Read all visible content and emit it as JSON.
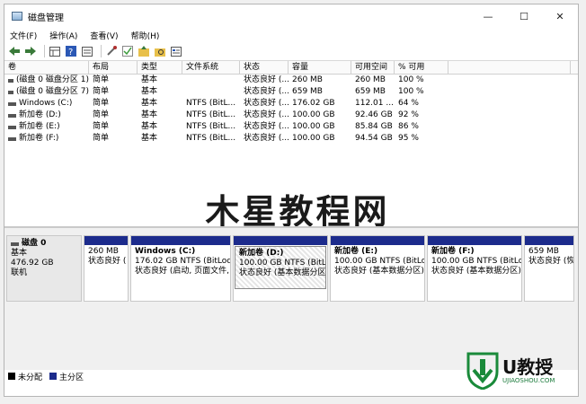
{
  "window": {
    "title": "磁盘管理",
    "controls": {
      "minimize": "—",
      "maximize": "☐",
      "close": "✕"
    }
  },
  "menu": [
    "文件(F)",
    "操作(A)",
    "查看(V)",
    "帮助(H)"
  ],
  "toolbar": [
    "back-icon",
    "forward-icon",
    "grid-icon",
    "help-icon",
    "list-icon",
    "connect-icon",
    "check-icon",
    "folder-up-icon",
    "folder-search-icon",
    "properties-icon"
  ],
  "columns": [
    "卷",
    "布局",
    "类型",
    "文件系统",
    "状态",
    "容量",
    "可用空间",
    "% 可用",
    ""
  ],
  "volumes": [
    {
      "vol": "(磁盘 0 磁盘分区 1)",
      "layout": "简单",
      "type": "基本",
      "fs": "",
      "status": "状态良好 (...",
      "capacity": "260 MB",
      "free": "260 MB",
      "pct": "100 %"
    },
    {
      "vol": "(磁盘 0 磁盘分区 7)",
      "layout": "简单",
      "type": "基本",
      "fs": "",
      "status": "状态良好 (...",
      "capacity": "659 MB",
      "free": "659 MB",
      "pct": "100 %"
    },
    {
      "vol": "Windows (C:)",
      "layout": "简单",
      "type": "基本",
      "fs": "NTFS (BitL...",
      "status": "状态良好 (...",
      "capacity": "176.02 GB",
      "free": "112.01 ...",
      "pct": "64 %"
    },
    {
      "vol": "新加卷 (D:)",
      "layout": "简单",
      "type": "基本",
      "fs": "NTFS (BitL...",
      "status": "状态良好 (...",
      "capacity": "100.00 GB",
      "free": "92.46 GB",
      "pct": "92 %"
    },
    {
      "vol": "新加卷 (E:)",
      "layout": "简单",
      "type": "基本",
      "fs": "NTFS (BitL...",
      "status": "状态良好 (...",
      "capacity": "100.00 GB",
      "free": "85.84 GB",
      "pct": "86 %"
    },
    {
      "vol": "新加卷 (F:)",
      "layout": "简单",
      "type": "基本",
      "fs": "NTFS (BitL...",
      "status": "状态良好 (...",
      "capacity": "100.00 GB",
      "free": "94.54 GB",
      "pct": "95 %"
    }
  ],
  "watermark": "木星教程网",
  "disk": {
    "name": "磁盘 0",
    "type": "基本",
    "size": "476.92 GB",
    "status": "联机",
    "partitions": [
      {
        "name": "",
        "size": "260 MB",
        "status": "状态良好 ("
      },
      {
        "name": "Windows  (C:)",
        "size": "176.02 GB NTFS (BitLocke",
        "status": "状态良好 (启动, 页面文件,"
      },
      {
        "name": "新加卷  (D:)",
        "size": "100.00 GB NTFS (BitLocl",
        "status": "状态良好 (基本数据分区)"
      },
      {
        "name": "新加卷  (E:)",
        "size": "100.00 GB NTFS (BitLocl",
        "status": "状态良好 (基本数据分区)"
      },
      {
        "name": "新加卷  (F:)",
        "size": "100.00 GB NTFS (BitLocl",
        "status": "状态良好 (基本数据分区)"
      },
      {
        "name": "",
        "size": "659 MB",
        "status": "状态良好 (恢"
      }
    ]
  },
  "legend": [
    {
      "label": "未分配",
      "color": "#000000"
    },
    {
      "label": "主分区",
      "color": "#1c2b8c"
    }
  ],
  "logo": {
    "main": "U教授",
    "sub": "UJIAOSHOU.COM"
  }
}
